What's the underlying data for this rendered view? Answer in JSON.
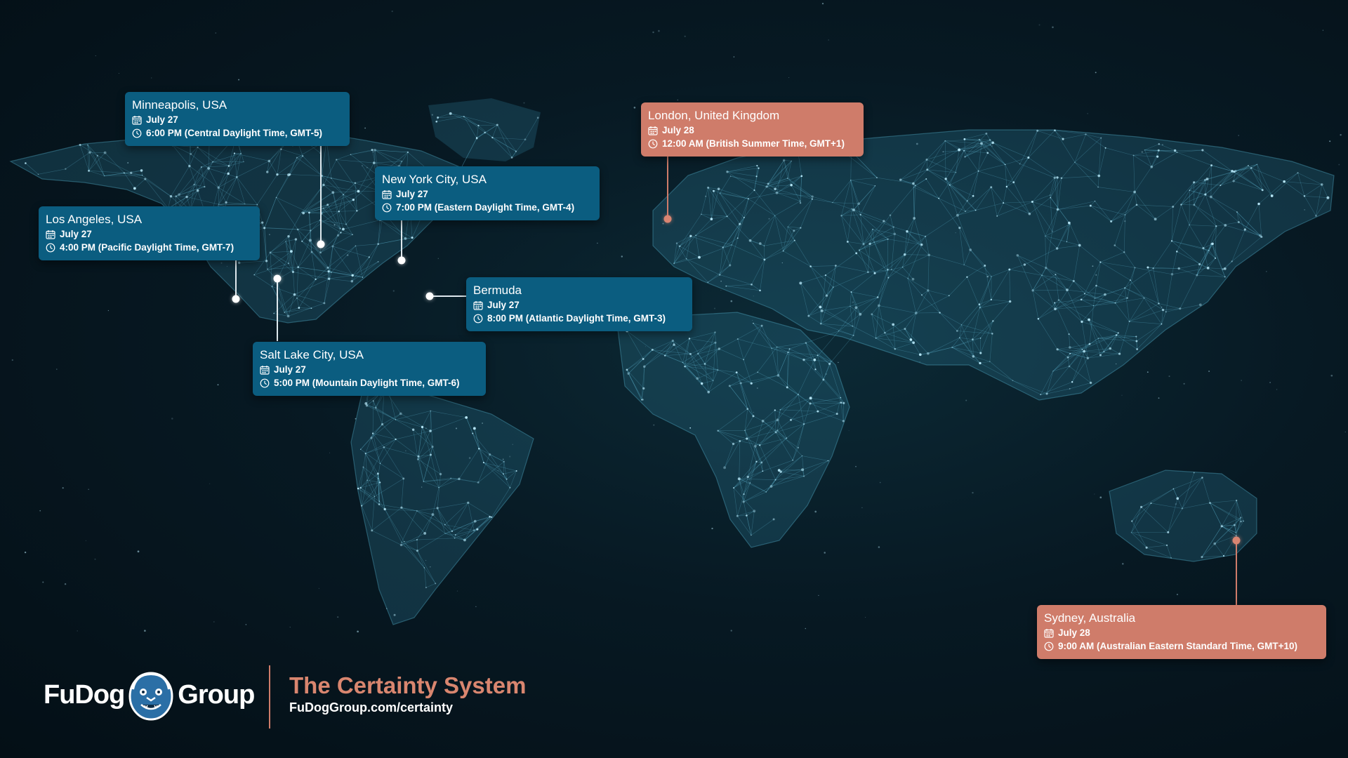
{
  "locations": [
    {
      "id": "minneapolis",
      "city": "Minneapolis, USA",
      "date": "July 27",
      "time": "6:00 PM (Central Daylight Time, GMT-5)",
      "theme": "blue"
    },
    {
      "id": "los-angeles",
      "city": "Los Angeles, USA",
      "date": "July 27",
      "time": "4:00 PM (Pacific Daylight Time, GMT-7)",
      "theme": "blue"
    },
    {
      "id": "new-york",
      "city": "New York City, USA",
      "date": "July 27",
      "time": "7:00 PM (Eastern Daylight Time, GMT-4)",
      "theme": "blue"
    },
    {
      "id": "bermuda",
      "city": "Bermuda",
      "date": "July 27",
      "time": "8:00 PM (Atlantic Daylight Time, GMT-3)",
      "theme": "blue"
    },
    {
      "id": "salt-lake",
      "city": "Salt Lake City, USA",
      "date": "July 27",
      "time": "5:00 PM (Mountain Daylight Time, GMT-6)",
      "theme": "blue"
    },
    {
      "id": "london",
      "city": "London, United Kingdom",
      "date": "July 28",
      "time": "12:00 AM (British Summer Time, GMT+1)",
      "theme": "salmon"
    },
    {
      "id": "sydney",
      "city": "Sydney, Australia",
      "date": "July 28",
      "time": "9:00 AM (Australian Eastern Standard Time, GMT+10)",
      "theme": "salmon"
    }
  ],
  "brand": {
    "name_left": "FuDog",
    "name_right": "Group",
    "tagline": "The Certainty System",
    "url": "FuDogGroup.com/certainty"
  },
  "colors": {
    "background": "#061820",
    "callout_blue": "#0b5d80",
    "callout_salmon": "#cf7c6a",
    "network": "#6fd0ee"
  },
  "icons": {
    "date": "calendar-icon",
    "time": "clock-icon"
  }
}
